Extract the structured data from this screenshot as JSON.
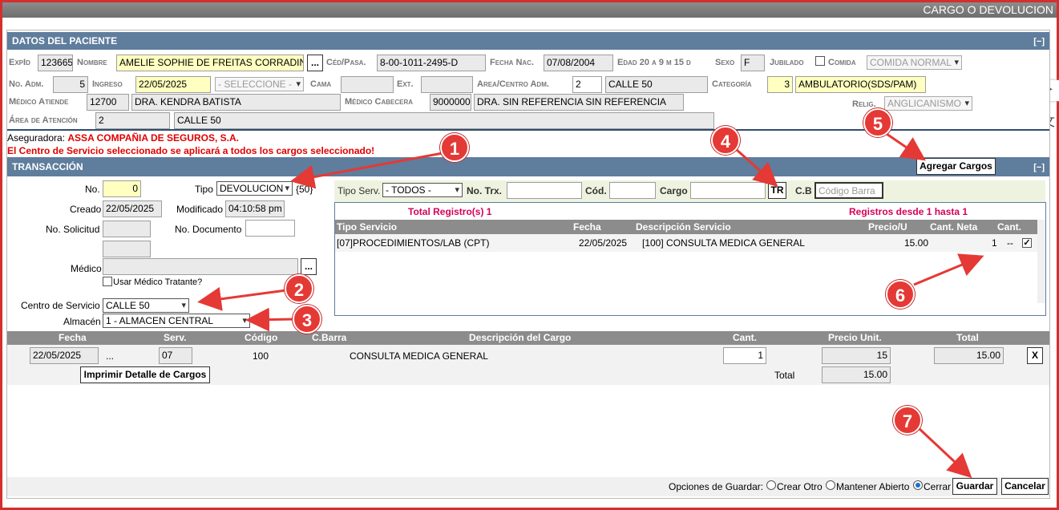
{
  "window": {
    "title": "CARGO O DEVOLUCION"
  },
  "patient": {
    "section_title": "DATOS DEL PACIENTE",
    "collapse": "[−]",
    "expid_label": "ExpId",
    "expid": "123665",
    "nombre_label": "Nombre",
    "nombre": "AMELIE SOPHIE DE FREITAS CORRADINE",
    "ellipsis": "...",
    "ced_label": "Céd/Pasa.",
    "ced": "8-00-1011-2495-D",
    "fecha_nac_label": "Fecha Nac.",
    "fecha_nac": "07/08/2004",
    "edad_text": "Edad 20 a 9 m 15 d",
    "sexo_label": "Sexo",
    "sexo": "F",
    "jubilado_label": "Jubilado",
    "comida_label": "Comida",
    "comida": "COMIDA NORMAL",
    "no_adm_label": "No. Adm.",
    "no_adm": "5",
    "ingreso_label": "Ingreso",
    "ingreso": "22/05/2025",
    "seleccione": "- SELECCIONE -",
    "cama_label": "Cama",
    "cama": "",
    "ext_label": "Ext.",
    "ext": "",
    "area_centro_label": "Area/Centro Adm.",
    "area_centro_code": "2",
    "area_centro": "CALLE 50",
    "categoria_label": "Categoría",
    "categoria_code": "3",
    "categoria": "AMBULATORIO(SDS/PAM)",
    "medico_atiende_label": "Médico Atiende",
    "medico_atiende_code": "12700",
    "medico_atiende": "DRA. KENDRA BATISTA",
    "medico_cabecera_label": "Médico Cabecera",
    "medico_cabecera_code": "9000000",
    "medico_cabecera": "DRA. SIN REFERENCIA SIN REFERENCIA",
    "relig_label": "Relig.",
    "relig": "ANGLICANISMO",
    "area_atencion_label": "Área de Atención",
    "area_atencion_code": "2",
    "area_atencion": "CALLE 50",
    "aseguradora_label": "Aseguradora:",
    "aseguradora": "ASSA COMPAÑIA DE SEGUROS, S.A.",
    "warning": "El Centro de Servicio seleccionado se aplicará a todos los cargos seleccionado!"
  },
  "transaction": {
    "section_title": "TRANSACCIÓN",
    "agregar_cargos": "Agregar Cargos",
    "no_label": "No.",
    "no": "0",
    "tipo_label": "Tipo",
    "tipo": "DEVOLUCION",
    "tipo_code": "{50}",
    "creado_label": "Creado",
    "creado": "22/05/2025",
    "modificado_label": "Modificado",
    "modificado": "04:10:58 pm",
    "no_solicitud_label": "No. Solicitud",
    "no_solicitud": "",
    "no_documento_label": "No. Documento",
    "no_documento": "",
    "medico_label": "Médico",
    "medico": "",
    "usar_medico": "Usar Médico Tratante?",
    "centro_servicio_label": "Centro de Servicio",
    "centro_servicio": "CALLE 50",
    "almacen_label": "Almacén",
    "almacen": "1 - ALMACEN CENTRAL"
  },
  "search": {
    "tipo_serv_label": "Tipo Serv.",
    "tipo_serv": "- TODOS -",
    "no_trx_label": "No. Trx.",
    "cod_label": "Cód.",
    "cargo_label": "Cargo",
    "tr_button": "TR",
    "cb_label": "C.B",
    "codigo_barra_placeholder": "Código Barra",
    "total_registros": "Total Registro(s) 1",
    "registros_rango": "Registros desde 1 hasta 1",
    "columns": [
      "Tipo Servicio",
      "Fecha",
      "Descripción Servicio",
      "Precio/U",
      "Cant. Neta",
      "Cant."
    ],
    "row": {
      "tipo": "[07]PROCEDIMIENTOS/LAB (CPT)",
      "fecha": "22/05/2025",
      "descripcion": "[100] CONSULTA MEDICA GENERAL",
      "precio": "15.00",
      "cant_neta": "1",
      "cant": "--"
    }
  },
  "charges": {
    "columns": [
      "Fecha",
      "Serv.",
      "Código",
      "C.Barra",
      "Descripción del Cargo",
      "Cant.",
      "Precio Unit.",
      "Total"
    ],
    "row": {
      "fecha": "22/05/2025",
      "serv": "07",
      "codigo": "100",
      "descripcion": "CONSULTA MEDICA GENERAL",
      "cant": "1",
      "precio": "15",
      "total": "15.00",
      "delete": "X"
    },
    "imprimir": "Imprimir Detalle de Cargos",
    "total_label": "Total",
    "total": "15.00"
  },
  "footer": {
    "opciones_label": "Opciones de Guardar:",
    "crear_otro": "Crear Otro",
    "mantener_abierto": "Mantener Abierto",
    "cerrar": "Cerrar",
    "guardar": "Guardar",
    "cancelar": "Cancelar"
  },
  "markers": [
    "1",
    "2",
    "3",
    "4",
    "5",
    "6",
    "7"
  ],
  "colors": {
    "header": "#5f7d9d",
    "annotation": "#e53935",
    "highlight": "#ffffc0",
    "alert": "#e00000"
  }
}
